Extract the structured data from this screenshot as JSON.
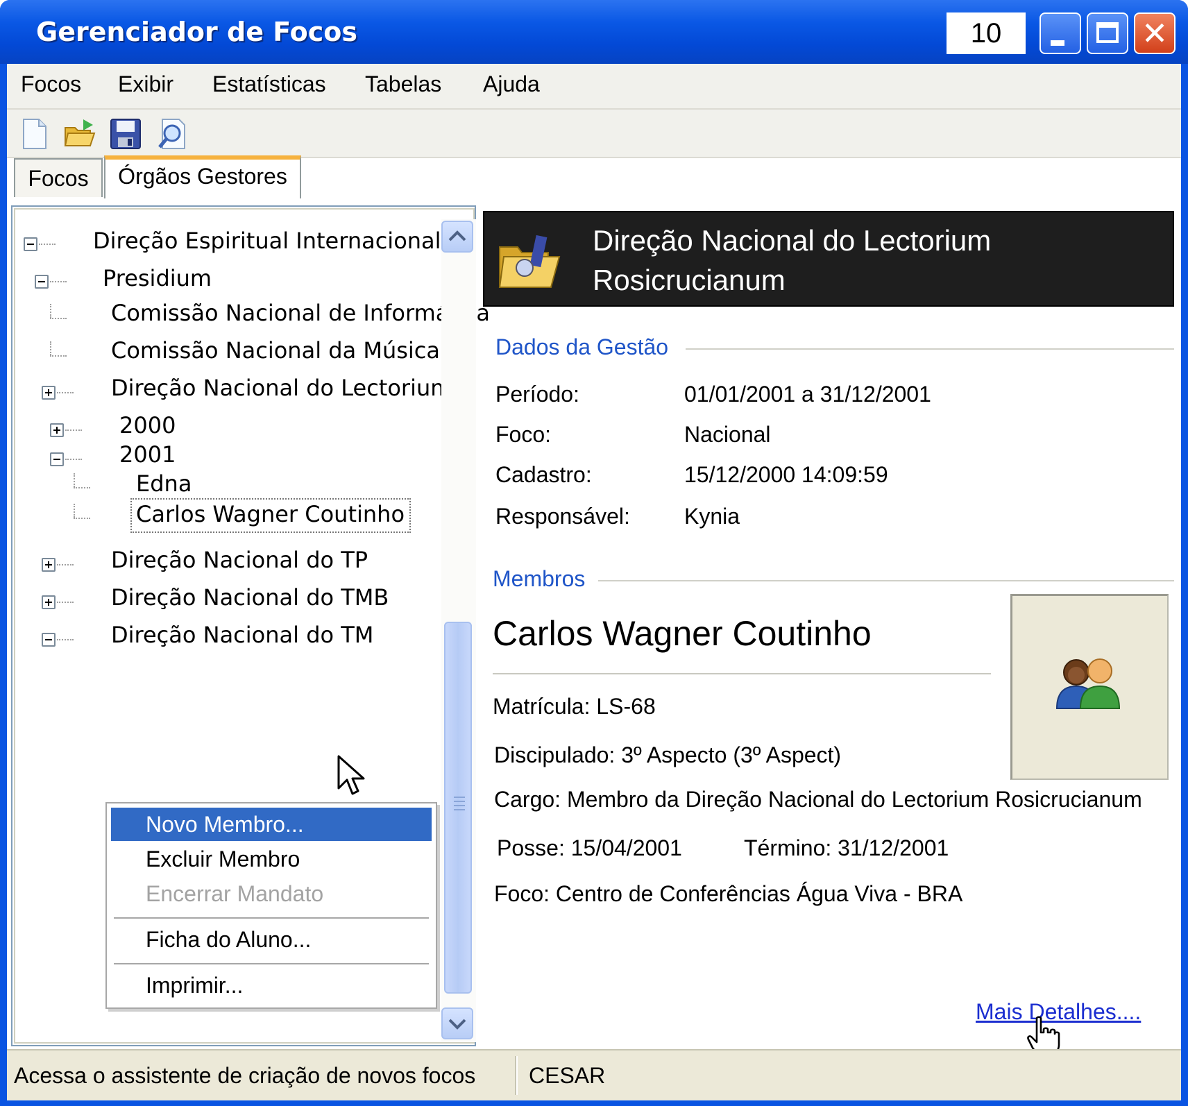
{
  "window": {
    "title": "Gerenciador de Focos",
    "counter": "10",
    "close_glyph": "✕"
  },
  "menu": {
    "items": [
      "Focos",
      "Exibir",
      "Estatísticas",
      "Tabelas",
      "Ajuda"
    ]
  },
  "toolbar": {
    "icons": [
      "new-document-icon",
      "open-folder-icon",
      "save-icon",
      "search-icon"
    ]
  },
  "tabs": [
    {
      "label": "Focos",
      "active": false
    },
    {
      "label": "Órgãos Gestores",
      "active": true
    }
  ],
  "tree": {
    "items": [
      {
        "label": "Direção Espiritual Internacional",
        "expander": "minus"
      },
      {
        "label": "Presidium",
        "expander": "minus"
      },
      {
        "label": "Comissão Nacional de Informática",
        "expander": "none"
      },
      {
        "label": "Comissão Nacional da Música",
        "expander": "none"
      },
      {
        "label": "Direção Nacional do Lectorium",
        "expander": "plus"
      },
      {
        "label": "2000",
        "expander": "plus"
      },
      {
        "label": "2001",
        "expander": "minus"
      },
      {
        "label": "Edna",
        "expander": "none"
      },
      {
        "label": "Carlos Wagner Coutinho",
        "expander": "none",
        "selected": true
      },
      {
        "label": "Direção Nacional do TP",
        "expander": "plus"
      },
      {
        "label": "Direção Nacional do TMB",
        "expander": "plus"
      },
      {
        "label": "Direção Nacional do TM",
        "expander": "minus"
      }
    ]
  },
  "context_menu": {
    "items": [
      {
        "label": "Novo Membro...",
        "state": "selected"
      },
      {
        "label": "Excluir Membro",
        "state": "normal"
      },
      {
        "label": "Encerrar Mandato",
        "state": "disabled"
      },
      {
        "label": "Ficha do Aluno...",
        "state": "normal"
      },
      {
        "label": "Imprimir...",
        "state": "normal"
      }
    ]
  },
  "detail": {
    "header_line1": "Direção Nacional do Lectorium",
    "header_line2": "Rosicrucianum",
    "gestao_section": "Dados da Gestão",
    "fields": [
      {
        "label": "Período:",
        "value": "01/01/2001 a 31/12/2001"
      },
      {
        "label": "Foco:",
        "value": "Nacional"
      },
      {
        "label": "Cadastro:",
        "value": "15/12/2000 14:09:59"
      },
      {
        "label": "Responsável:",
        "value": "Kynia"
      }
    ],
    "membros_section": "Membros",
    "member_name": "Carlos Wagner Coutinho",
    "matricula": "Matrícula: LS-68",
    "discipulado": "Discipulado: 3º Aspecto (3º Aspect)",
    "cargo": "Cargo: Membro da Direção Nacional do Lectorium Rosicrucianum",
    "posse": "Posse: 15/04/2001",
    "termino": "Término: 31/12/2001",
    "foco": "Foco: Centro de Conferências Água Viva - BRA",
    "more_link": "Mais Detalhes...."
  },
  "status": {
    "message": "Acessa o assistente de criação de novos focos",
    "user": "CESAR"
  },
  "colors": {
    "titlebar": "#0a54e2",
    "selection": "#316ac5",
    "section_label": "#1f55c8",
    "link": "#1b2ed0",
    "active_tab_accent": "#f6b23e"
  }
}
